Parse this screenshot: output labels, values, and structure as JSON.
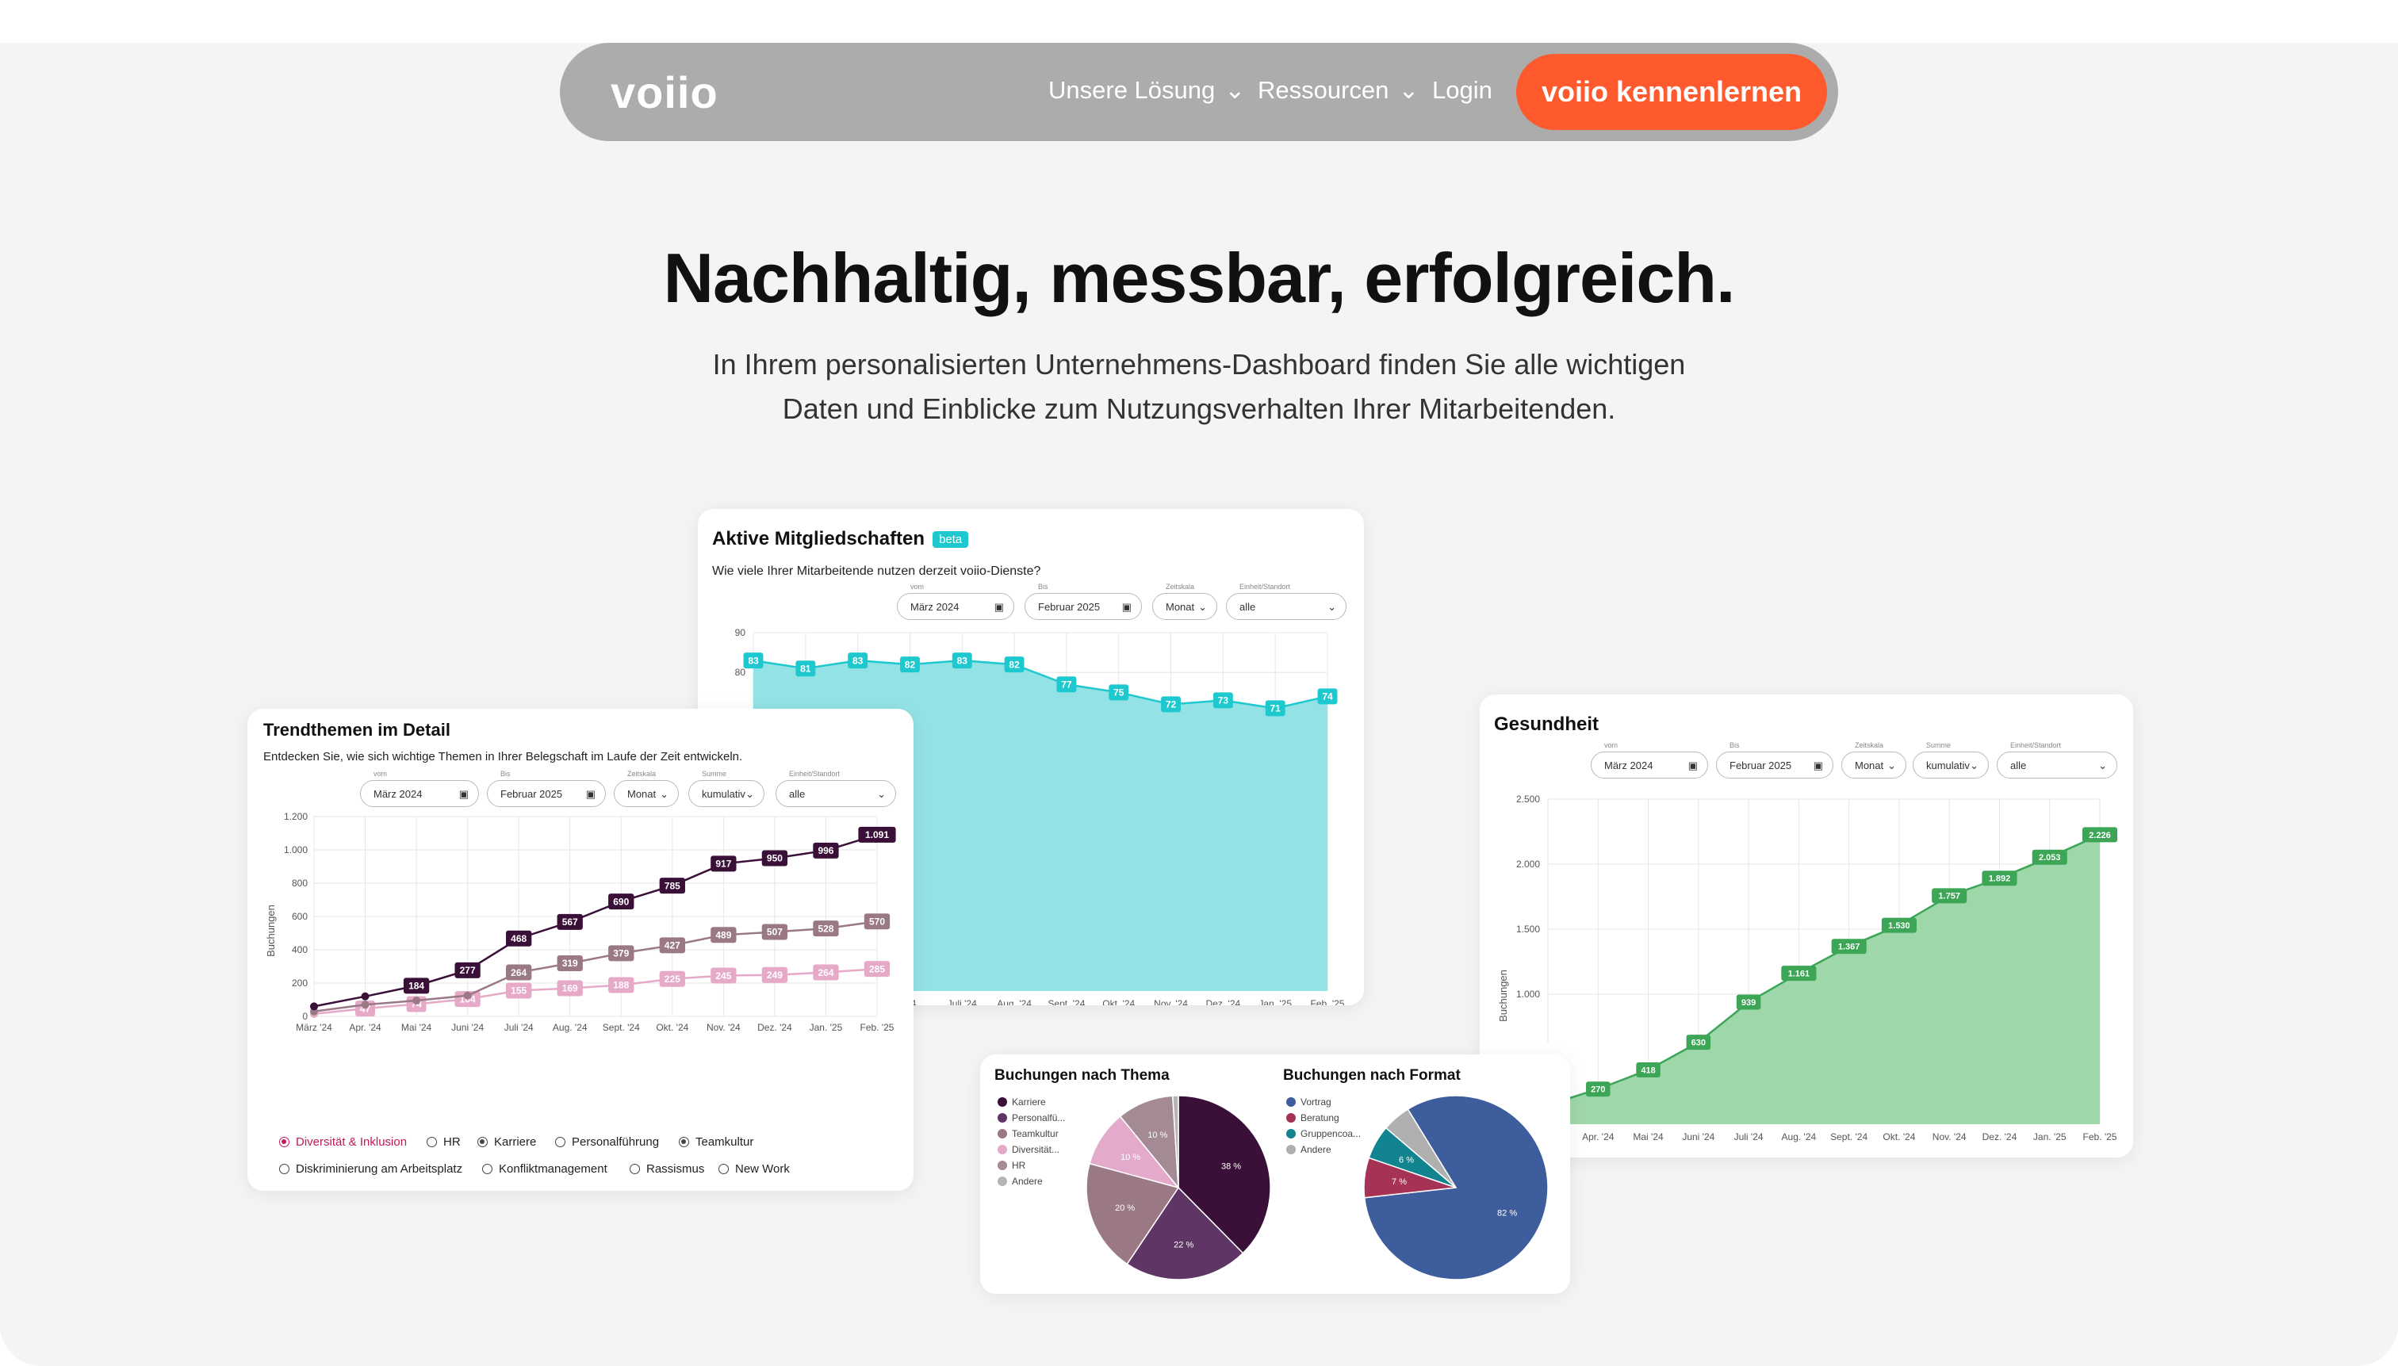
{
  "nav": {
    "logo": "voiio",
    "items": [
      "Unsere Lösung",
      "Ressourcen"
    ],
    "login": "Login",
    "cta": "voiio kennenlernen"
  },
  "hero": {
    "headline": "Nachhaltig, messbar, erfolgreich.",
    "subline": "In Ihrem personalisierten Unternehmens-Dashboard finden Sie alle wichtigen Daten und Einblicke zum Nutzungsverhalten Ihrer Mitarbeitenden."
  },
  "active": {
    "title": "Aktive Mitgliedschaften",
    "badge": "beta",
    "desc": "Wie viele Ihrer Mitarbeitende nutzen derzeit voiio-Dienste?",
    "filters": [
      {
        "label": "vom",
        "value": "März 2024"
      },
      {
        "label": "Bis",
        "value": "Februar 2025"
      },
      {
        "label": "Zeitskala",
        "value": "Monat"
      },
      {
        "label": "Einheit/Standort",
        "value": "alle"
      }
    ]
  },
  "trend": {
    "title": "Trendthemen im Detail",
    "desc": "Entdecken Sie, wie sich wichtige Themen in Ihrer Belegschaft im Laufe der Zeit entwickeln.",
    "filters": [
      {
        "label": "vom",
        "value": "März 2024"
      },
      {
        "label": "Bis",
        "value": "Februar 2025"
      },
      {
        "label": "Zeitskala",
        "value": "Monat"
      },
      {
        "label": "Summe",
        "value": "kumulativ"
      },
      {
        "label": "Einheit/Standort",
        "value": "alle"
      }
    ],
    "legend": [
      {
        "label": "Diversität & Inklusion",
        "on": true,
        "color": "#c2185b"
      },
      {
        "label": "HR",
        "on": false
      },
      {
        "label": "Karriere",
        "on": true
      },
      {
        "label": "Personalführung",
        "on": false
      },
      {
        "label": "Teamkultur",
        "on": true
      },
      {
        "label": "Diskriminierung am Arbeitsplatz",
        "on": false
      },
      {
        "label": "Konfliktmanagement",
        "on": false
      },
      {
        "label": "Rassismus",
        "on": false
      },
      {
        "label": "New Work",
        "on": false
      }
    ]
  },
  "health": {
    "title": "Gesundheit",
    "filters": [
      {
        "label": "vom",
        "value": "März 2024"
      },
      {
        "label": "Bis",
        "value": "Februar 2025"
      },
      {
        "label": "Zeitskala",
        "value": "Monat"
      },
      {
        "label": "Summe",
        "value": "kumulativ"
      },
      {
        "label": "Einheit/Standort",
        "value": "alle"
      }
    ]
  },
  "pies": {
    "thema_title": "Buchungen nach Thema",
    "format_title": "Buchungen nach Format"
  },
  "chart_data": [
    {
      "type": "area",
      "title": "Aktive Mitgliedschaften",
      "categories": [
        "März '24",
        "Apr. '24",
        "Mai '24",
        "Juni '24",
        "Juli '24",
        "Aug. '24",
        "Sept. '24",
        "Okt. '24",
        "Nov. '24",
        "Dez. '24",
        "Jan. '25",
        "Feb. '25"
      ],
      "x_tick_labels_visible": [
        "'24",
        "Juli '24",
        "Aug. '24",
        "Sept. '24",
        "Okt. '24",
        "Nov. '24",
        "Dez. '24",
        "Jan. '25",
        "Feb. '25"
      ],
      "values": [
        83,
        81,
        83,
        82,
        83,
        82,
        77,
        75,
        72,
        73,
        71,
        74
      ],
      "ytick_labels_visible": [
        "90",
        "80"
      ],
      "ylim": [
        0,
        90
      ],
      "color": "#1ec8cf",
      "grid": true
    },
    {
      "type": "line",
      "title": "Trendthemen im Detail",
      "ylabel": "Buchungen",
      "categories": [
        "März '24",
        "Apr. '24",
        "Mai '24",
        "Juni '24",
        "Juli '24",
        "Aug. '24",
        "Sept. '24",
        "Okt. '24",
        "Nov. '24",
        "Dez. '24",
        "Jan. '25",
        "Feb. '25"
      ],
      "ylim": [
        0,
        1200
      ],
      "yticks": [
        "0",
        "200",
        "400",
        "600",
        "800",
        "1.000",
        "1.200"
      ],
      "series": [
        {
          "name": "Karriere",
          "color": "#3a1038",
          "values": [
            60,
            120,
            184,
            277,
            468,
            567,
            690,
            785,
            917,
            950,
            996,
            1091
          ],
          "labels": [
            "",
            "",
            "184",
            "277",
            "468",
            "567",
            "690",
            "785",
            "917",
            "950",
            "996",
            "1.091"
          ]
        },
        {
          "name": "Teamkultur",
          "color": "#9a7886",
          "values": [
            30,
            70,
            95,
            125,
            264,
            319,
            379,
            427,
            489,
            507,
            528,
            570
          ],
          "labels": [
            "",
            "",
            "",
            "",
            "264",
            "319",
            "379",
            "427",
            "489",
            "507",
            "528",
            "570"
          ]
        },
        {
          "name": "Diversität & Inklusion",
          "color": "#e6a9c7",
          "values": [
            15,
            47,
            74,
            104,
            155,
            169,
            188,
            225,
            245,
            249,
            264,
            285
          ],
          "labels": [
            "",
            "47",
            "74",
            "104",
            "155",
            "169",
            "188",
            "225",
            "245",
            "249",
            "264",
            "285"
          ]
        }
      ],
      "grid": true
    },
    {
      "type": "area",
      "title": "Gesundheit",
      "ylabel": "Buchungen",
      "categories": [
        "März '24",
        "Apr. '24",
        "Mai '24",
        "Juni '24",
        "Juli '24",
        "Aug. '24",
        "Sept. '24",
        "Okt. '24",
        "Nov. '24",
        "Dez. '24",
        "Jan. '25",
        "Feb. '25"
      ],
      "values": [
        270,
        418,
        630,
        939,
        1161,
        1367,
        1530,
        1757,
        1892,
        2053,
        2226
      ],
      "labels": [
        "270",
        "418",
        "630",
        "939",
        "1.161",
        "1.367",
        "1.530",
        "1.757",
        "1.892",
        "2.053",
        "2.226"
      ],
      "x_tick_labels_visible": [
        "Apr. '24",
        "Mai '24",
        "Juni '24",
        "Juli '24",
        "Aug. '24",
        "Sept. '24",
        "Okt. '24",
        "Nov. '24",
        "Dez. '24",
        "Jan. '25",
        "Feb. '25"
      ],
      "ylim": [
        0,
        2500
      ],
      "yticks": [
        "1.000",
        "1.500",
        "2.000",
        "2.500"
      ],
      "color": "#3ca556",
      "grid": true
    },
    {
      "type": "pie",
      "title": "Buchungen nach Thema",
      "legend": [
        "Karriere",
        "Personalfü...",
        "Teamkultur",
        "Diversität...",
        "HR",
        "Andere"
      ],
      "slices": [
        {
          "label": "38 %",
          "value": 38,
          "color": "#3a1038"
        },
        {
          "label": "22 %",
          "value": 22,
          "color": "#5e3565"
        },
        {
          "label": "20 %",
          "value": 20,
          "color": "#9a7886"
        },
        {
          "label": "10 %",
          "value": 10,
          "color": "#e3aacb"
        },
        {
          "label": "10 %",
          "value": 10,
          "color": "#a38a95"
        },
        {
          "label": "",
          "value": 1,
          "color": "#b5b5b5"
        }
      ]
    },
    {
      "type": "pie",
      "title": "Buchungen nach Format",
      "legend": [
        "Vortrag",
        "Beratung",
        "Gruppencoa...",
        "Andere"
      ],
      "slices": [
        {
          "label": "82 %",
          "value": 82,
          "color": "#3d5d9c"
        },
        {
          "label": "7 %",
          "value": 7,
          "color": "#a63356"
        },
        {
          "label": "6 %",
          "value": 6,
          "color": "#12848f"
        },
        {
          "label": "",
          "value": 5,
          "color": "#b0b0b0"
        }
      ]
    }
  ]
}
